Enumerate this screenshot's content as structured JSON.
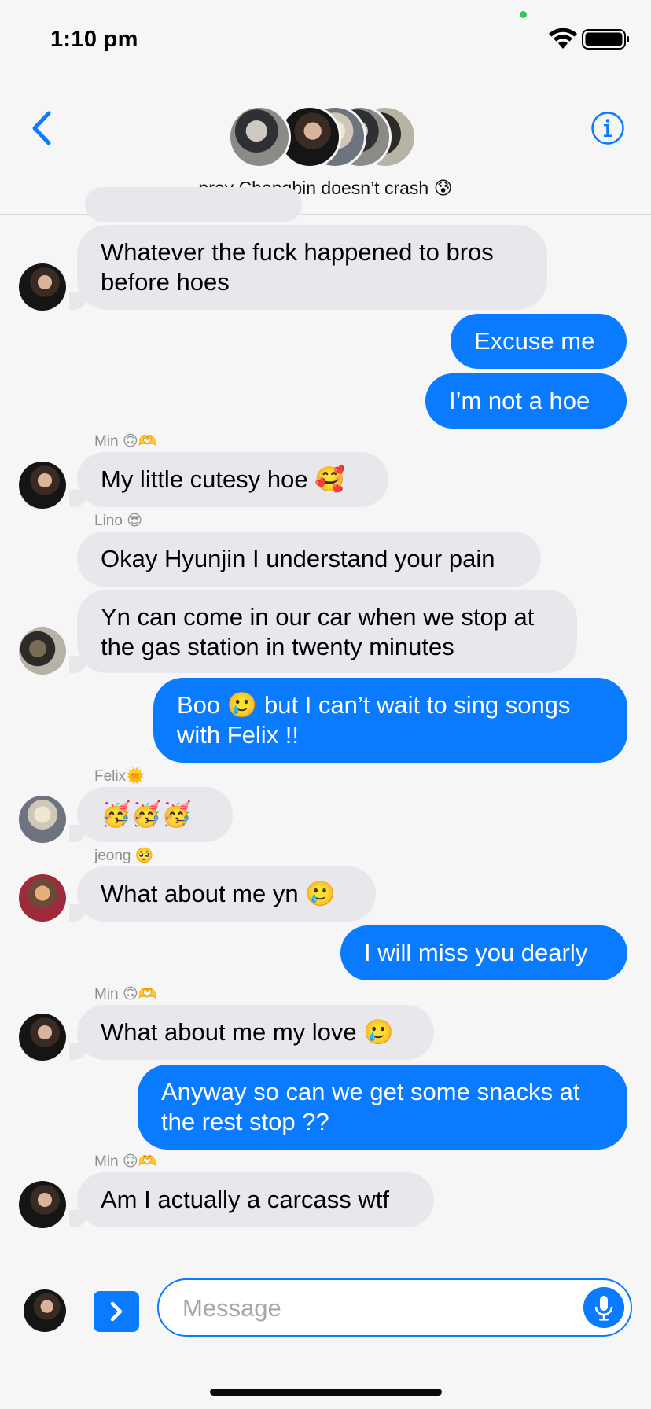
{
  "status_bar": {
    "time": "1:10 pm",
    "wifi_icon": "wifi-icon",
    "battery_icon": "battery-icon"
  },
  "header": {
    "back_icon": "chevron-left-icon",
    "info_icon": "info-icon",
    "group_title": "pray Changbin doesn’t crash 😰"
  },
  "messages": [
    {
      "text": "Whatever the fuck happened to bros\nbefore hoes",
      "dir": "in"
    },
    {
      "text": "Excuse me",
      "dir": "out"
    },
    {
      "text": "I’m not a hoe",
      "dir": "out"
    },
    {
      "sender": "Min 🙃🫶",
      "text": "My little cutesy hoe 🥰",
      "dir": "in"
    },
    {
      "sender": "Lino 😎",
      "text": "Okay Hyunjin I understand your pain",
      "dir": "in"
    },
    {
      "text": "Yn can come in our car when we stop at\nthe gas station in twenty minutes",
      "dir": "in"
    },
    {
      "text": "Boo 🥲 but I can’t wait to sing songs\nwith Felix !!",
      "dir": "out"
    },
    {
      "sender": "Felix🌞",
      "text": "🥳🥳🥳",
      "dir": "in"
    },
    {
      "sender": "jeong 🥺",
      "text": "What about me yn 🥲",
      "dir": "in"
    },
    {
      "text": "I will miss you dearly",
      "dir": "out"
    },
    {
      "sender": "Min 🙃🫶",
      "text": "What about me my love 🥲",
      "dir": "in"
    },
    {
      "text": "Anyway so can we get some snacks at\nthe rest stop ??",
      "dir": "out"
    },
    {
      "sender": "Min 🙃🫶",
      "text": "Am I actually a carcass wtf",
      "dir": "in"
    }
  ],
  "composer": {
    "placeholder": "Message",
    "apps_icon": "chevron-right-icon",
    "mic_icon": "microphone-icon"
  },
  "colors": {
    "accent": "#0a7aff",
    "incoming_bubble": "#e8e7ec",
    "background": "#f6f6f6"
  }
}
